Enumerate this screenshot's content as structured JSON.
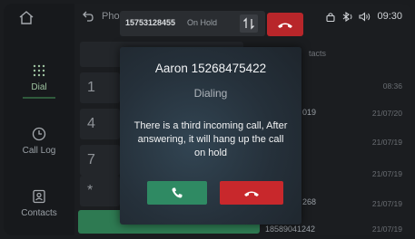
{
  "sidebar": {
    "home_icon": "home-icon",
    "items": [
      {
        "label": "Dial",
        "icon": "dialpad-icon",
        "active": true
      },
      {
        "label": "Call Log",
        "icon": "clock-icon",
        "active": false
      },
      {
        "label": "Contacts",
        "icon": "contacts-icon",
        "active": false
      }
    ]
  },
  "topbar": {
    "title": "Pho",
    "time": "09:30",
    "status_icons": [
      "lock-icon",
      "bluetooth-icon",
      "volume-icon"
    ]
  },
  "holdbar": {
    "number": "15753128455",
    "status": "On Hold"
  },
  "keypad": {
    "keys": [
      "1",
      "4",
      "7",
      "*"
    ]
  },
  "list": {
    "header": "tacts",
    "rows": [
      {
        "name": "",
        "date": "08:36"
      },
      {
        "name": "019",
        "date": "21/07/20"
      },
      {
        "name": "",
        "date": "21/07/19"
      },
      {
        "name": "",
        "date": "21/07/19"
      },
      {
        "name": "268",
        "date": "21/07/19"
      },
      {
        "name": "18589041242",
        "date": "21/07/19"
      }
    ]
  },
  "dialog": {
    "caller": "Aaron  15268475422",
    "state": "Dialing",
    "message": "There is a third incoming call, After answering, it will hang up the call on hold"
  },
  "colors": {
    "answer": "#2f8a63",
    "reject": "#c8282c",
    "background": "#1b1d20"
  }
}
